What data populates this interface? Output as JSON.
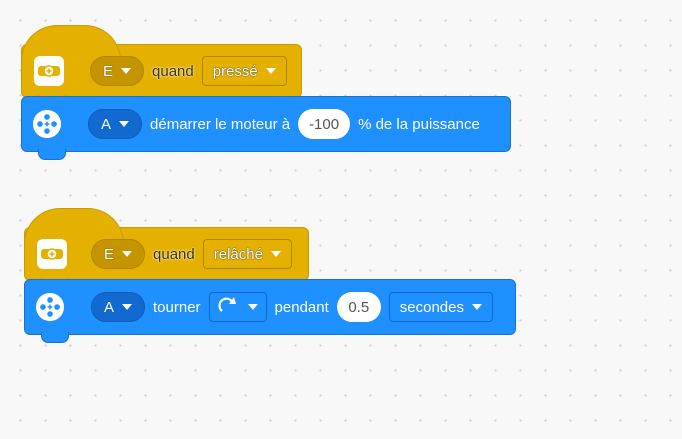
{
  "stack1": {
    "hat": {
      "icon": "remote-button-icon",
      "port": "E",
      "word": "quand",
      "state": "pressé"
    },
    "cmd": {
      "icon": "motor-icon",
      "port": "A",
      "text1": "démarrer le moteur à",
      "value": "-100",
      "text2": "% de la puissance"
    }
  },
  "stack2": {
    "hat": {
      "icon": "remote-button-icon",
      "port": "E",
      "word": "quand",
      "state": "relâché"
    },
    "cmd": {
      "icon": "motor-icon",
      "port": "A",
      "text1": "tourner",
      "direction_icon": "clockwise-arrow-icon",
      "text2": "pendant",
      "value": "0.5",
      "unit": "secondes"
    }
  },
  "colors": {
    "event": "#e5b100",
    "motor": "#1e90ff"
  }
}
